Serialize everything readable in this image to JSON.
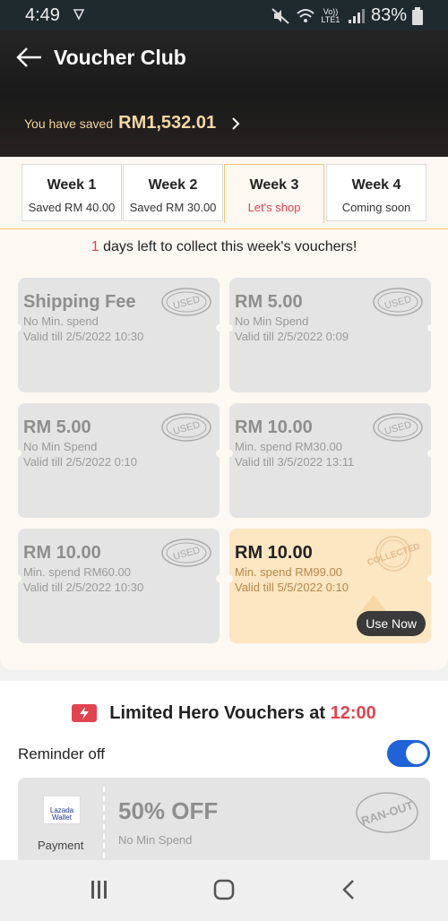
{
  "status_bar": {
    "time": "4:49",
    "network": "Vo)) LTE1",
    "battery": "83%"
  },
  "header": {
    "title": "Voucher Club",
    "saved_label": "You have saved",
    "saved_amount": "RM1,532.01"
  },
  "tabs": [
    {
      "name": "Week 1",
      "sub": "Saved RM 40.00"
    },
    {
      "name": "Week 2",
      "sub": "Saved RM 30.00"
    },
    {
      "name": "Week 3",
      "sub": "Let's shop"
    },
    {
      "name": "Week 4",
      "sub": "Coming soon"
    }
  ],
  "notice": {
    "days": "1",
    "text": " days left to collect this week's vouchers!"
  },
  "vouchers": [
    {
      "title": "Shipping Fee",
      "min": "No Min. spend",
      "valid": "Valid till 2/5/2022 10:30",
      "stamp": "USED"
    },
    {
      "title": "RM 5.00",
      "min": "No Min Spend",
      "valid": "Valid till 2/5/2022 0:09",
      "stamp": "USED"
    },
    {
      "title": "RM 5.00",
      "min": "No Min Spend",
      "valid": "Valid till 2/5/2022 0:10",
      "stamp": "USED"
    },
    {
      "title": "RM 10.00",
      "min": "Min. spend RM30.00",
      "valid": "Valid till 3/5/2022 13:11",
      "stamp": "USED"
    },
    {
      "title": "RM 10.00",
      "min": "Min. spend RM60.00",
      "valid": "Valid till 2/5/2022 10:30",
      "stamp": "USED"
    },
    {
      "title": "RM 10.00",
      "min": "Min. spend RM99.00",
      "valid": "Valid till 5/5/2022 0:10",
      "stamp": "COLLECTED",
      "button": "Use Now"
    }
  ],
  "hero": {
    "title": "Limited Hero Vouchers at ",
    "time": "12:00",
    "reminder_label": "Reminder off",
    "card": {
      "logo_text": "Lazada Wallet",
      "pay_label": "Payment",
      "offer": "50% OFF",
      "min": "No Min Spend",
      "stamp": "RAN-OUT"
    }
  },
  "colors": {
    "accent_red": "#e0444f",
    "toggle_blue": "#1f63d6",
    "gold": "#f5d8a6"
  }
}
